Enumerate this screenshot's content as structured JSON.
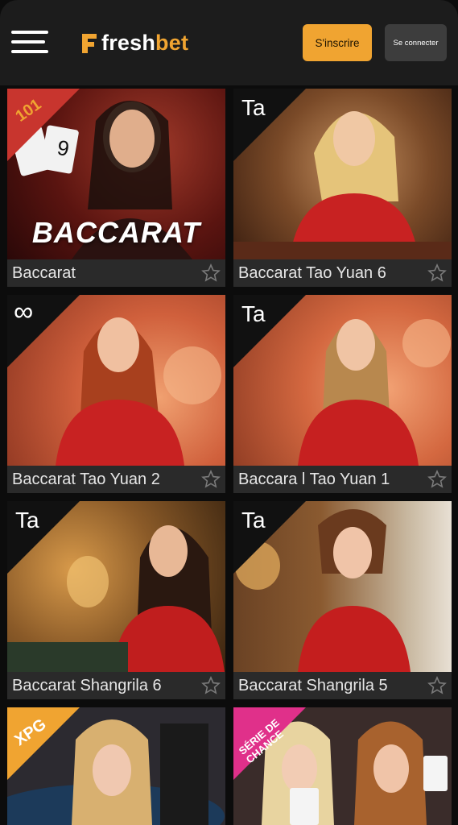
{
  "header": {
    "logo_fresh": "fresh",
    "logo_bet": "bet",
    "signup_label": "S'inscrire",
    "login_label": "Se connecter"
  },
  "colors": {
    "accent": "#f0a431",
    "header_bg": "#1c1c1c",
    "card_bar": "#2a2a2a"
  },
  "games": [
    {
      "name": "Baccarat",
      "badge": "101",
      "thumb_title": "BACCARAT"
    },
    {
      "name": "Baccarat Tao Yuan 6",
      "badge": "Ta"
    },
    {
      "name": "Baccarat Tao Yuan 2",
      "badge": "∞"
    },
    {
      "name": "Baccara l Tao Yuan 1",
      "badge": "Ta"
    },
    {
      "name": "Baccarat Shangrila 6",
      "badge": "Ta"
    },
    {
      "name": "Baccarat Shangrila 5",
      "badge": "Ta"
    },
    {
      "name": "",
      "badge": "XPG"
    },
    {
      "name": "",
      "badge": "SÉRIE DE CHANCE"
    }
  ]
}
